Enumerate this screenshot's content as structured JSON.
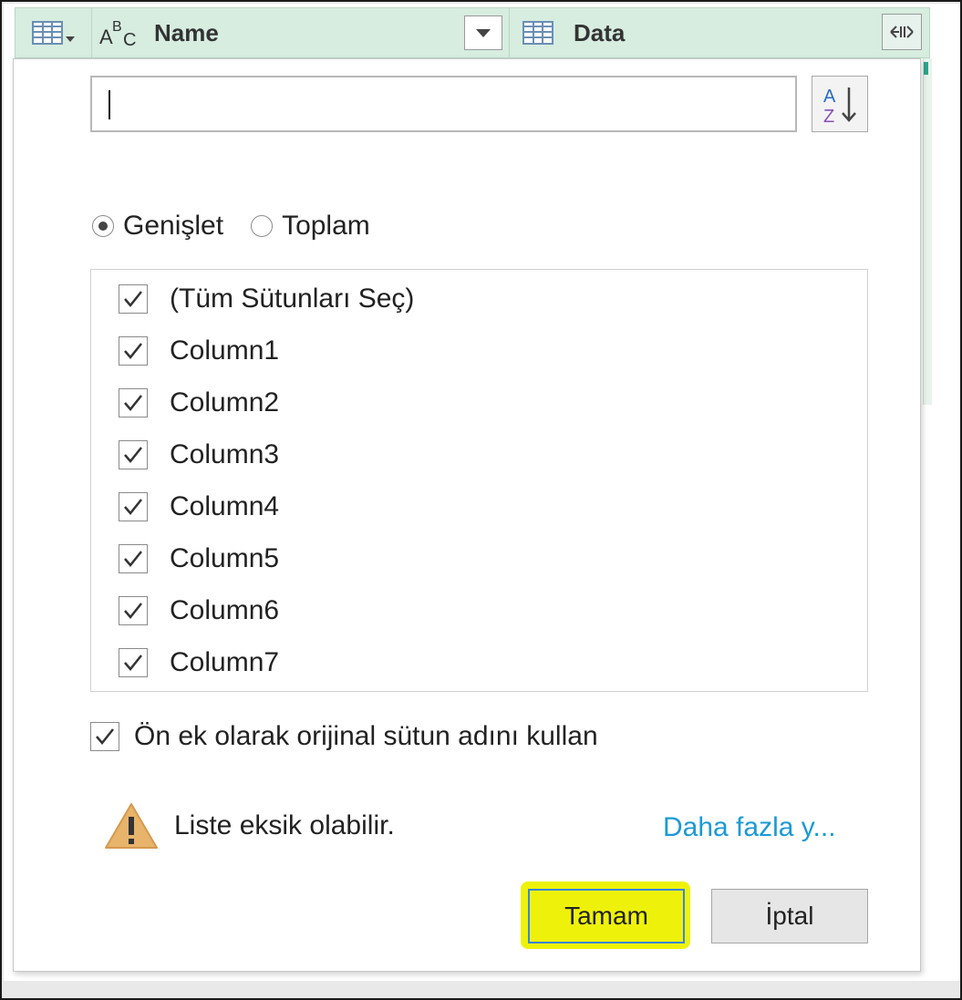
{
  "header": {
    "name_label": "Name",
    "data_label": "Data",
    "type_icon_text": "A B C"
  },
  "search": {
    "value": "",
    "placeholder": ""
  },
  "mode": {
    "options": [
      {
        "label": "Genişlet",
        "selected": true
      },
      {
        "label": "Toplam",
        "selected": false
      }
    ]
  },
  "columns": {
    "items": [
      {
        "label": "(Tüm Sütunları Seç)",
        "checked": true
      },
      {
        "label": "Column1",
        "checked": true
      },
      {
        "label": "Column2",
        "checked": true
      },
      {
        "label": "Column3",
        "checked": true
      },
      {
        "label": "Column4",
        "checked": true
      },
      {
        "label": "Column5",
        "checked": true
      },
      {
        "label": "Column6",
        "checked": true
      },
      {
        "label": "Column7",
        "checked": true
      }
    ]
  },
  "prefix": {
    "label": "Ön ek olarak orijinal sütun adını kullan",
    "checked": true
  },
  "warning": {
    "text": "Liste eksik olabilir.",
    "link": "Daha fazla y..."
  },
  "buttons": {
    "ok": "Tamam",
    "cancel": "İptal"
  },
  "colors": {
    "header_bg": "#d6ede0",
    "highlight": "#eef20a",
    "link": "#1a9ad6",
    "warning": "#e8b36a"
  }
}
